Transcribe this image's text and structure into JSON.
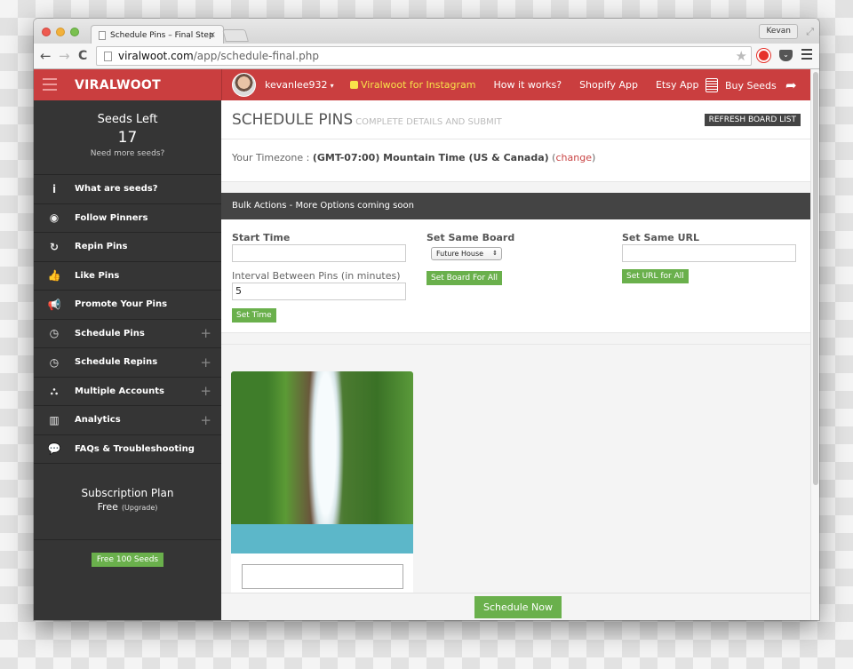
{
  "browser": {
    "tab_title": "Schedule Pins – Final Step",
    "tab_close": "×",
    "profile_name": "Kevan",
    "url_host": "viralwoot.com",
    "url_path": "/app/schedule-final.php",
    "icons": {
      "back": "←",
      "forward": "→",
      "reload": "C",
      "star": "★",
      "fullscreen": "⤢"
    }
  },
  "header": {
    "logo": "VIRALWOOT",
    "username": "kevanlee932",
    "caret": "▾",
    "nav": [
      {
        "label": "Viralwoot for Instagram",
        "highlight": true
      },
      {
        "label": "How it works?"
      },
      {
        "label": "Shopify App"
      },
      {
        "label": "Etsy App"
      }
    ],
    "buy_seeds": "Buy Seeds",
    "logout_icon": "➦",
    "colors": {
      "bar": "#ca3e3f",
      "highlight": "#f9e24a"
    }
  },
  "sidebar": {
    "seeds_title": "Seeds Left",
    "seeds_count": "17",
    "seeds_more": "Need more seeds?",
    "items": [
      {
        "label": "What are seeds?",
        "icon": "i",
        "expandable": false
      },
      {
        "label": "Follow Pinners",
        "icon": "◉",
        "expandable": false
      },
      {
        "label": "Repin Pins",
        "icon": "↻",
        "expandable": false
      },
      {
        "label": "Like Pins",
        "icon": "👍",
        "expandable": false
      },
      {
        "label": "Promote Your Pins",
        "icon": "📢",
        "expandable": false
      },
      {
        "label": "Schedule Pins",
        "icon": "◷",
        "expandable": true
      },
      {
        "label": "Schedule Repins",
        "icon": "◷",
        "expandable": true
      },
      {
        "label": "Multiple Accounts",
        "icon": "⛬",
        "expandable": true
      },
      {
        "label": "Analytics",
        "icon": "▥",
        "expandable": true
      },
      {
        "label": "FAQs & Troubleshooting",
        "icon": "💬",
        "expandable": false
      }
    ],
    "plus_glyph": "+",
    "plan_title": "Subscription Plan",
    "plan_name": "Free",
    "plan_upgrade": "(Upgrade)",
    "free_seeds_button": "Free 100 Seeds"
  },
  "main": {
    "title": "SCHEDULE PINS",
    "subtitle": "COMPLETE DETAILS AND SUBMIT",
    "refresh_button": "REFRESH BOARD LIST",
    "timezone_label": "Your Timezone : ",
    "timezone_value": "(GMT-07:00) Mountain Time (US & Canada)",
    "timezone_change_open": " (",
    "timezone_change": "change",
    "timezone_change_close": ")",
    "bulk": {
      "heading": "Bulk Actions - More Options coming soon",
      "start_time_label": "Start Time",
      "start_time_value": "",
      "interval_label": "Interval Between Pins (in minutes)",
      "interval_value": "5",
      "set_time_button": "Set Time",
      "board_label": "Set Same Board",
      "board_selected": "Future House",
      "board_arrows": "⇕",
      "set_board_button": "Set Board For All",
      "url_label": "Set Same URL",
      "url_value": "",
      "set_url_button": "Set URL for All"
    },
    "pins": [
      {
        "image": "waterfall-photo",
        "caption": ""
      }
    ],
    "schedule_button": "Schedule Now",
    "accent_green": "#6ab04c"
  }
}
